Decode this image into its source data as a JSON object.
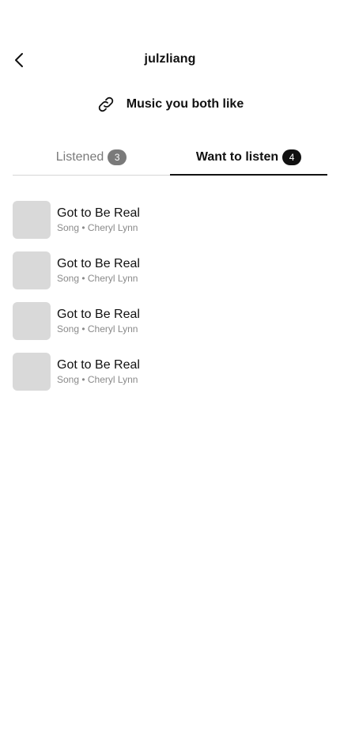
{
  "header": {
    "title": "julzliang",
    "back_icon": "chevron-left-icon"
  },
  "shared": {
    "icon": "link-icon",
    "label": "Music you both like"
  },
  "tabs": [
    {
      "label": "Listened",
      "count": "3",
      "active": false
    },
    {
      "label": "Want to listen",
      "count": "4",
      "active": true
    }
  ],
  "items": [
    {
      "title": "Got to Be Real",
      "subtitle": "Song • Cheryl Lynn"
    },
    {
      "title": "Got to Be Real",
      "subtitle": "Song • Cheryl Lynn"
    },
    {
      "title": "Got to Be Real",
      "subtitle": "Song • Cheryl Lynn"
    },
    {
      "title": "Got to Be Real",
      "subtitle": "Song • Cheryl Lynn"
    }
  ],
  "colors": {
    "text": "#111111",
    "muted": "#7a7a7a",
    "artwork_placeholder": "#d9d9d9",
    "divider": "#d6d6d6"
  }
}
